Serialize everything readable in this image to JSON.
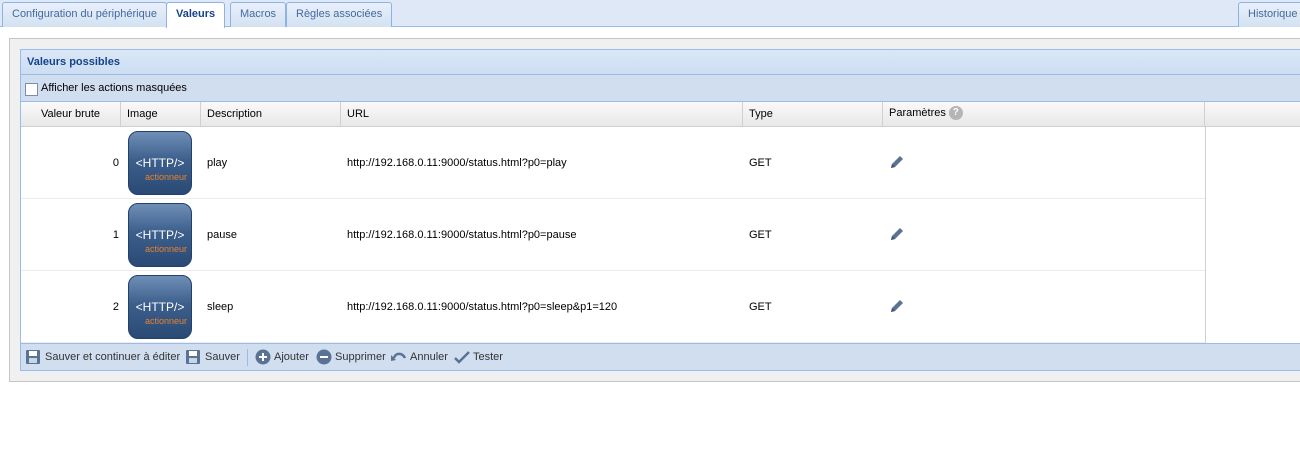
{
  "tabs": [
    {
      "label": "Configuration du périphérique",
      "active": false
    },
    {
      "label": "Valeurs",
      "active": true
    },
    {
      "label": "Macros",
      "active": false
    },
    {
      "label": "Règles associées",
      "active": false
    }
  ],
  "history_tab": "Historique",
  "panel": {
    "title": "Valeurs possibles",
    "show_hidden_label": "Afficher les actions masquées",
    "show_hidden_checked": false
  },
  "grid": {
    "columns": {
      "raw_value": "Valeur brute",
      "image": "Image",
      "description": "Description",
      "url": "URL",
      "type": "Type",
      "params": "Paramètres"
    },
    "help_glyph": "?",
    "image_caption": {
      "main": "<HTTP/>",
      "sub": "actionneur"
    },
    "rows": [
      {
        "value": "0",
        "description": "play",
        "url": "http://192.168.0.11:9000/status.html?p0=play",
        "type": "GET"
      },
      {
        "value": "1",
        "description": "pause",
        "url": "http://192.168.0.11:9000/status.html?p0=pause",
        "type": "GET"
      },
      {
        "value": "2",
        "description": "sleep",
        "url": "http://192.168.0.11:9000/status.html?p0=sleep&p1=120",
        "type": "GET"
      }
    ]
  },
  "toolbar": {
    "save_continue": "Sauver et continuer à éditer",
    "save": "Sauver",
    "add": "Ajouter",
    "delete": "Supprimer",
    "cancel": "Annuler",
    "test": "Tester"
  },
  "colors": {
    "header_text": "#15428b",
    "toolbar_bg": "#d0def0",
    "border": "#99bbe8",
    "icon_blue": "#5a7394",
    "accent_orange": "#e8822b"
  }
}
